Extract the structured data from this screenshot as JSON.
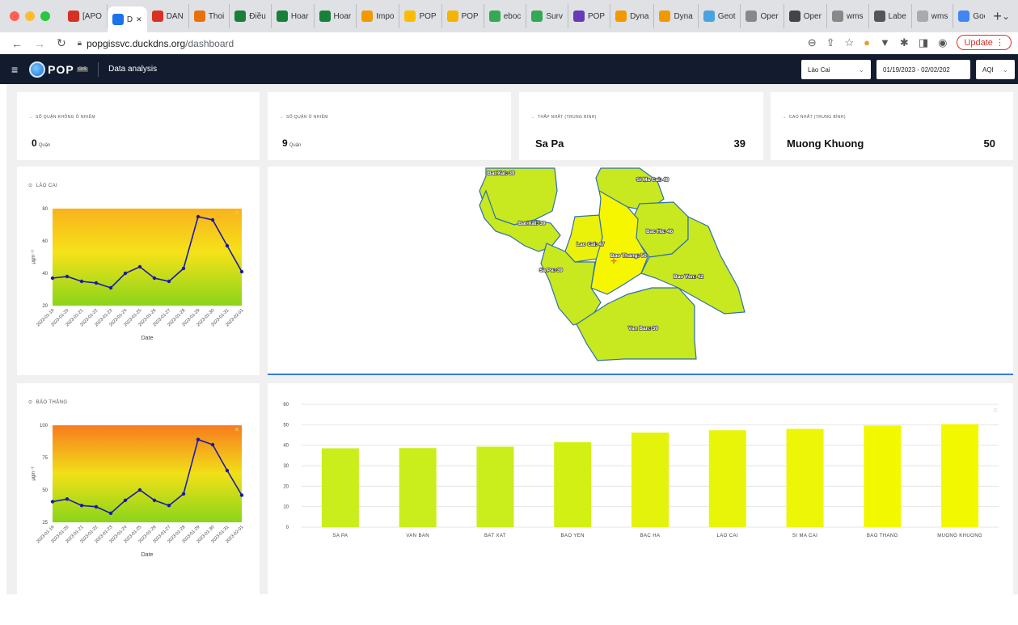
{
  "browser": {
    "tabs": [
      {
        "label": "[APO",
        "icon": "gmail-icon",
        "color": "#d93025"
      },
      {
        "label": "D",
        "icon": "app-icon",
        "color": "#1a73e8",
        "active": true
      },
      {
        "label": "DAN",
        "icon": "gmail-icon",
        "color": "#d93025"
      },
      {
        "label": "Thoi",
        "icon": "rainbow-icon",
        "color": "#e8710a"
      },
      {
        "label": "Điều",
        "icon": "sheets-icon",
        "color": "#188038"
      },
      {
        "label": "Hoar",
        "icon": "sheets-icon",
        "color": "#188038"
      },
      {
        "label": "Hoar",
        "icon": "sheets-icon",
        "color": "#188038"
      },
      {
        "label": "Impo",
        "icon": "app-icon",
        "color": "#f29900"
      },
      {
        "label": "POP",
        "icon": "drive-icon",
        "color": "#fbbc04"
      },
      {
        "label": "POP",
        "icon": "slides-icon",
        "color": "#f4b400"
      },
      {
        "label": "eboc",
        "icon": "drive-icon",
        "color": "#34a853"
      },
      {
        "label": "Surv",
        "icon": "drive-icon",
        "color": "#34a853"
      },
      {
        "label": "POP",
        "icon": "forms-icon",
        "color": "#673ab7"
      },
      {
        "label": "Dyna",
        "icon": "app-icon",
        "color": "#f29900"
      },
      {
        "label": "Dyna",
        "icon": "app-icon",
        "color": "#f29900"
      },
      {
        "label": "Geot",
        "icon": "geo-icon",
        "color": "#4aa3df"
      },
      {
        "label": "Oper",
        "icon": "chart-icon",
        "color": "#888888"
      },
      {
        "label": "Oper",
        "icon": "globe-icon",
        "color": "#444444"
      },
      {
        "label": "wms",
        "icon": "chart-icon",
        "color": "#888888"
      },
      {
        "label": "Labe",
        "icon": "doc-icon",
        "color": "#555555"
      },
      {
        "label": "wms",
        "icon": "doc-icon",
        "color": "#aaaaaa"
      },
      {
        "label": "Goog",
        "icon": "docs-icon",
        "color": "#4285f4"
      }
    ],
    "url_host": "popgissvc.duckdns.org",
    "url_path": "/dashboard",
    "update_label": "Update"
  },
  "app": {
    "logo_text": "POP",
    "logo_sub": "GIS",
    "title": "Data analysis",
    "province_select": "Lào Cai",
    "date_range": "01/19/2023 - 02/02/202",
    "metric_select": "AQI"
  },
  "stats": [
    {
      "label": "SỐ QUẬN KHÔNG Ô NHIỄM",
      "value": "0",
      "unit": "Quận"
    },
    {
      "label": "SỐ QUẬN Ô NHIỄM",
      "value": "9",
      "unit": "Quận"
    },
    {
      "label": "THẤP NHẤT (TRUNG BÌNH)",
      "name": "Sa Pa",
      "value": "39"
    },
    {
      "label": "CAO NHẤT (TRUNG BÌNH)",
      "name": "Muong Khuong",
      "value": "50"
    }
  ],
  "map": {
    "districts": [
      {
        "label": "Bat Xat: 39",
        "fill": "#c8e820"
      },
      {
        "label": "Bat Xat: 39",
        "fill": "#c8e820"
      },
      {
        "label": "Si Ma Cai: 48",
        "fill": "#c8e820"
      },
      {
        "label": "Lao Cai: 47",
        "fill": "#eaf20a"
      },
      {
        "label": "Bac Ha: 46",
        "fill": "#c8e820"
      },
      {
        "label": "Bao Thang: 50",
        "fill": "#f6f600"
      },
      {
        "label": "Sa Pa: 39",
        "fill": "#c8e820"
      },
      {
        "label": "Bao Yen: 42",
        "fill": "#c8e820"
      },
      {
        "label": "Van Ban: 39",
        "fill": "#c8e820"
      }
    ]
  },
  "chart_data": [
    {
      "type": "line",
      "title": "LÀO CAI",
      "xlabel": "Date",
      "ylabel": "μgm⁻³",
      "x": [
        "2023-01-19",
        "2023-01-20",
        "2023-01-21",
        "2023-01-22",
        "2023-01-23",
        "2023-01-24",
        "2023-01-25",
        "2023-01-26",
        "2023-01-27",
        "2023-01-28",
        "2023-01-29",
        "2023-01-30",
        "2023-01-31",
        "2023-02-01"
      ],
      "values": [
        37,
        38,
        35,
        34,
        31,
        40,
        44,
        37,
        35,
        43,
        75,
        73,
        57,
        41
      ],
      "ylim": [
        20,
        80
      ],
      "yticks": [
        20,
        40,
        60,
        80
      ],
      "line_color": "#1a1aa8"
    },
    {
      "type": "line",
      "title": "BẢO THẮNG",
      "xlabel": "Date",
      "ylabel": "μgm⁻³",
      "x": [
        "2023-01-19",
        "2023-01-20",
        "2023-01-21",
        "2023-01-22",
        "2023-01-23",
        "2023-01-24",
        "2023-01-25",
        "2023-01-26",
        "2023-01-27",
        "2023-01-28",
        "2023-01-29",
        "2023-01-30",
        "2023-01-31",
        "2023-02-01"
      ],
      "values": [
        41,
        43,
        38,
        37,
        32,
        42,
        50,
        42,
        38,
        47,
        89,
        85,
        65,
        46
      ],
      "ylim": [
        25,
        100
      ],
      "yticks": [
        25,
        50,
        75,
        100
      ],
      "line_color": "#1a1aa8"
    },
    {
      "type": "bar",
      "categories": [
        "SA PA",
        "VAN BAN",
        "BAT XAT",
        "BAO YEN",
        "BAC HA",
        "LAO CAI",
        "SI MA CAI",
        "BAO THANG",
        "MUONG KHUONG"
      ],
      "values": [
        38.5,
        38.6,
        39.3,
        41.5,
        46.2,
        47.3,
        48.0,
        49.6,
        50.3
      ],
      "colors": [
        "#c9ee1b",
        "#c9ee1b",
        "#c9ee1b",
        "#d2f014",
        "#e3f30c",
        "#e9f508",
        "#ecf606",
        "#f2f800",
        "#f2f800"
      ],
      "ylim": [
        0,
        60
      ],
      "yticks": [
        0,
        10,
        20,
        30,
        40,
        50,
        60
      ]
    }
  ]
}
